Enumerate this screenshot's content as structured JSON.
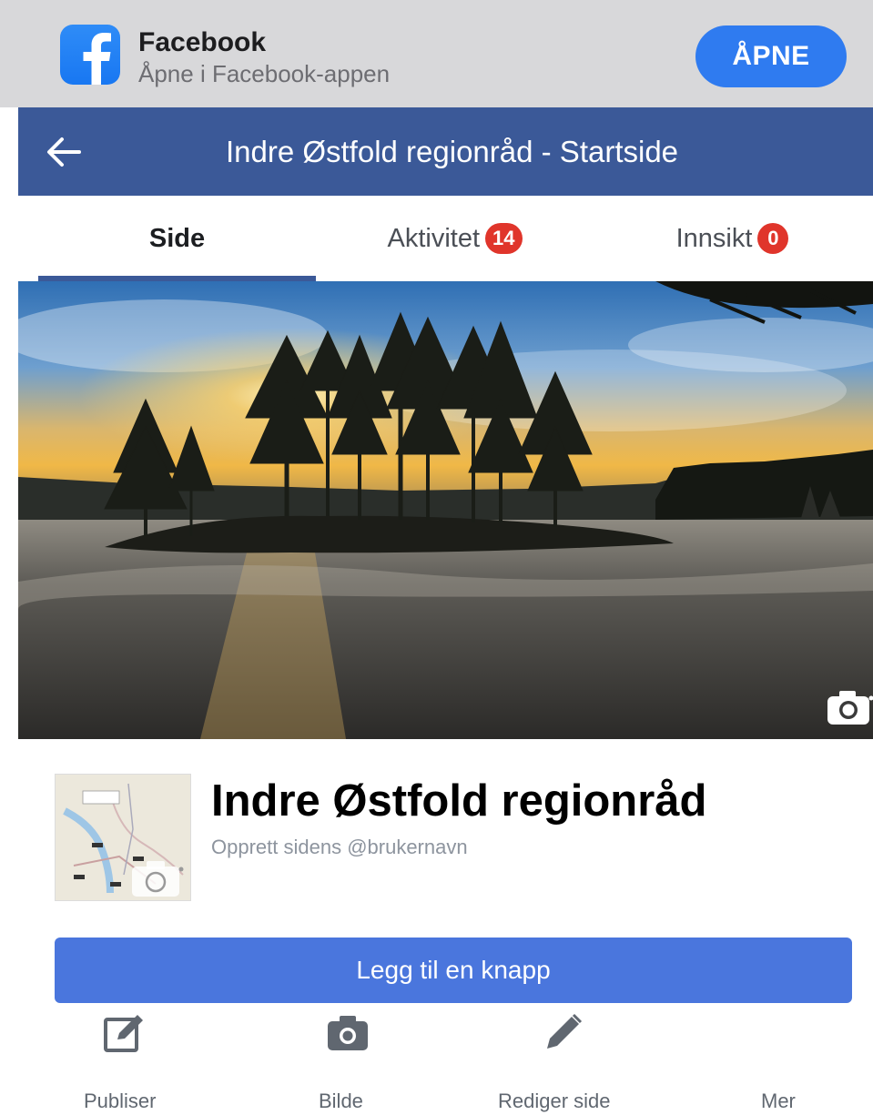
{
  "banner": {
    "app_name": "Facebook",
    "subtitle": "Åpne i Facebook-appen",
    "open_label": "ÅPNE",
    "logo_icon": "facebook-logo-icon",
    "accent_color": "#2f7bf0"
  },
  "header": {
    "back_icon": "back-arrow-icon",
    "title": "Indre Østfold regionråd - Startside",
    "bar_color": "#3b5998"
  },
  "tabs": [
    {
      "label": "Side",
      "badge": "",
      "active": true
    },
    {
      "label": "Aktivitet",
      "badge": "14",
      "active": false
    },
    {
      "label": "Innsikt",
      "badge": "0",
      "active": false
    }
  ],
  "cover": {
    "camera_icon": "camera-icon"
  },
  "profile": {
    "name": "Indre Østfold regionråd",
    "username_prompt": "Opprett sidens @brukernavn",
    "camera_icon": "camera-icon"
  },
  "primary_action": {
    "label": "Legg til en knapp",
    "color": "#4a76dd"
  },
  "actions": [
    {
      "label": "Publiser",
      "icon": "compose-icon"
    },
    {
      "label": "Bilde",
      "icon": "camera-icon"
    },
    {
      "label": "Rediger side",
      "icon": "pencil-icon"
    },
    {
      "label": "Mer",
      "icon": "more-icon"
    }
  ]
}
